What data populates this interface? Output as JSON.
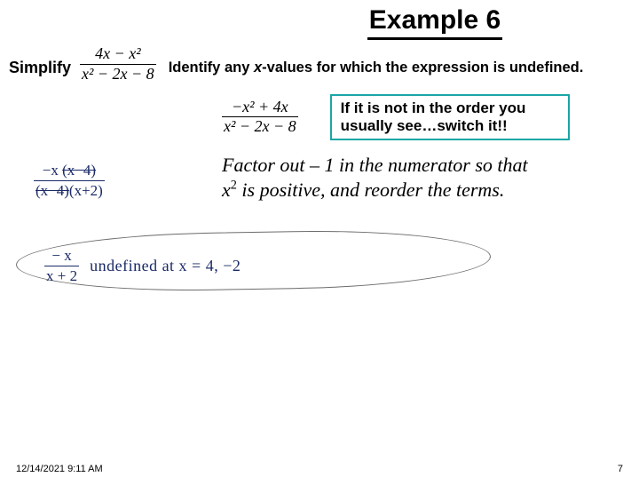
{
  "title": "Example 6",
  "simplify_label": "Simplify",
  "expr1": {
    "num": "4x − x²",
    "den": "x² − 2x − 8"
  },
  "identify_text_pre": "Identify any ",
  "identify_x": "x",
  "identify_text_post": "-values for which the expression is  undefined.",
  "expr2": {
    "num": "−x² + 4x",
    "den": "x² − 2x − 8"
  },
  "tip_line1": "If it is not in the order you",
  "tip_line2": "usually see…switch it!!",
  "factor_note_1": "Factor out – 1 in the numerator so that",
  "factor_note_2a": "x",
  "factor_note_2b": " is positive, and reorder the terms.",
  "hw1": {
    "num_pre": "−x ",
    "num_strike": "(x−4)",
    "den_strike": "(x−4)",
    "den_post": "(x+2)"
  },
  "hw2": {
    "num": "− x",
    "den": "x + 2",
    "note": "undefined at x = 4, −2"
  },
  "footer": {
    "date": "12/14/2021 9:11 AM",
    "page": "7"
  }
}
